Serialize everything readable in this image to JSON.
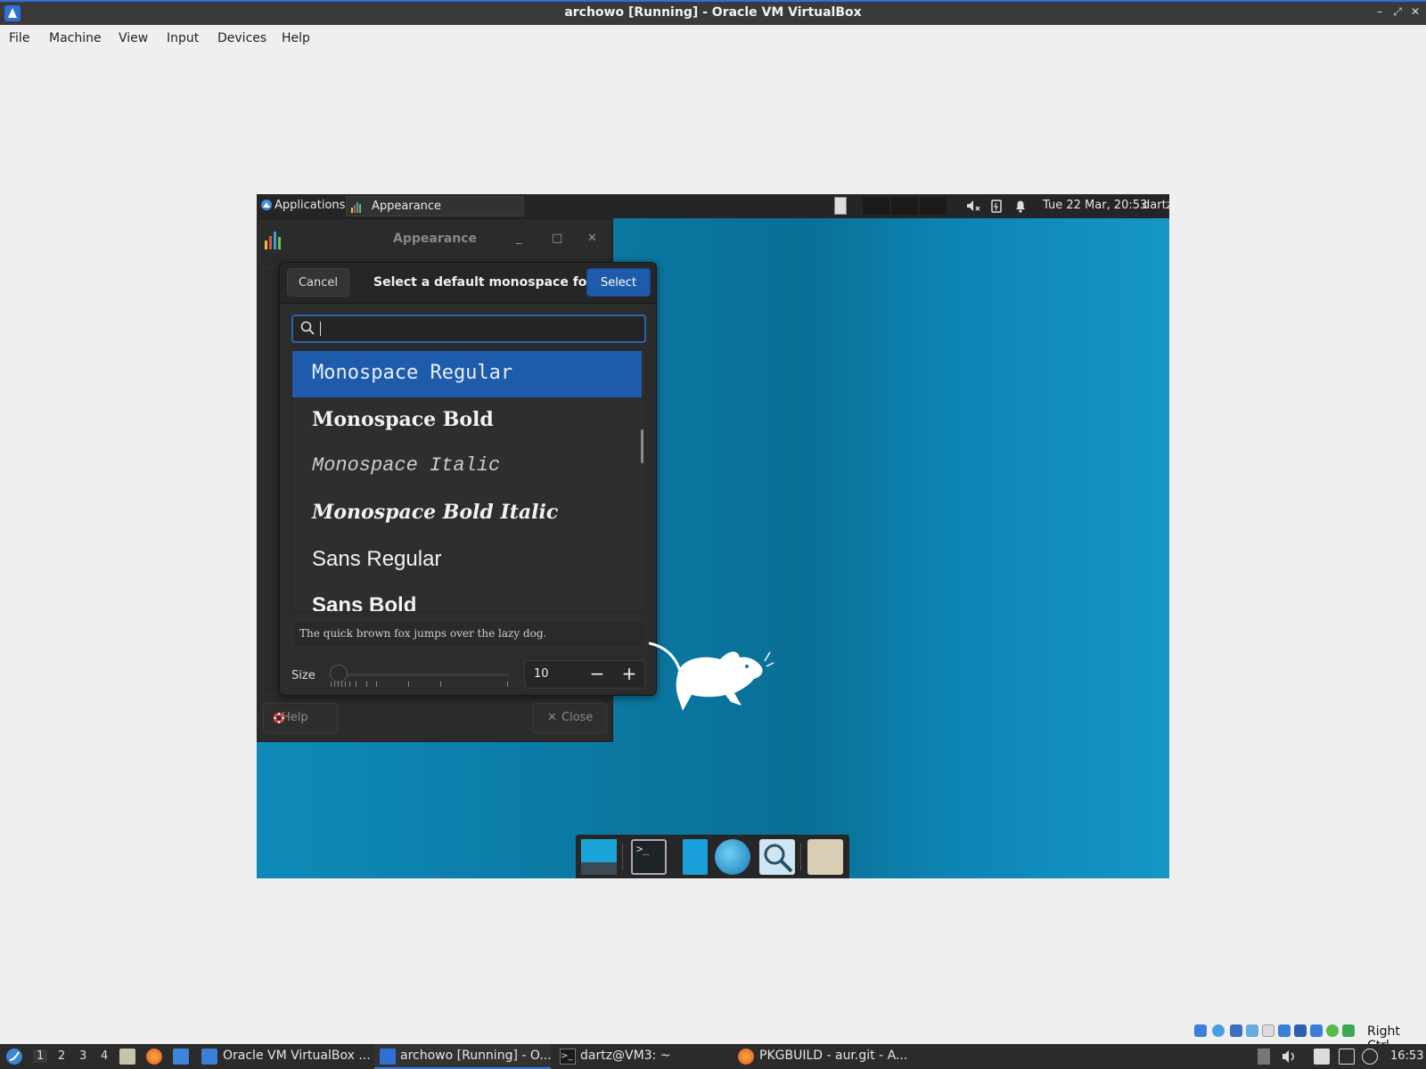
{
  "host": {
    "window_title": "archowo [Running] - Oracle VM VirtualBox",
    "menu": [
      "File",
      "Machine",
      "View",
      "Input",
      "Devices",
      "Help"
    ],
    "window_controls": [
      "–",
      "⤢",
      "✕"
    ],
    "tray_right_label": "Right Ctrl",
    "taskbar": {
      "workspaces": [
        "1",
        "2",
        "3",
        "4"
      ],
      "items": [
        {
          "label": "Oracle VM VirtualBox ..."
        },
        {
          "label": "archowo [Running] - O..."
        },
        {
          "label": "dartz@VM3: ~"
        },
        {
          "label": "PKGBUILD - aur.git - A..."
        }
      ],
      "clock": "16:53"
    }
  },
  "guest": {
    "panel": {
      "applications_label": "Applications",
      "task_label": "Appearance",
      "clock": "Tue 22 Mar, 20:53",
      "user": "dartz"
    },
    "appearance_window": {
      "title": "Appearance",
      "help_label": "Help",
      "close_label": "Close",
      "controls": [
        "_",
        "□",
        "✕"
      ]
    },
    "font_dialog": {
      "cancel_label": "Cancel",
      "title": "Select a default monospace font",
      "select_label": "Select",
      "search_value": "",
      "fonts": [
        {
          "name": "Monospace Regular",
          "selected": true
        },
        {
          "name": "Monospace Bold",
          "selected": false
        },
        {
          "name": "Monospace Italic",
          "selected": false
        },
        {
          "name": "Monospace Bold Italic",
          "selected": false
        },
        {
          "name": "Sans Regular",
          "selected": false
        },
        {
          "name": "Sans Bold",
          "selected": false
        }
      ],
      "preview_text": "The quick brown fox jumps over the lazy dog.",
      "size_label": "Size",
      "size_value": "10",
      "minus": "−",
      "plus": "+"
    }
  },
  "colors": {
    "accent": "#1f5bab",
    "desktop": "#0b7ca7"
  }
}
